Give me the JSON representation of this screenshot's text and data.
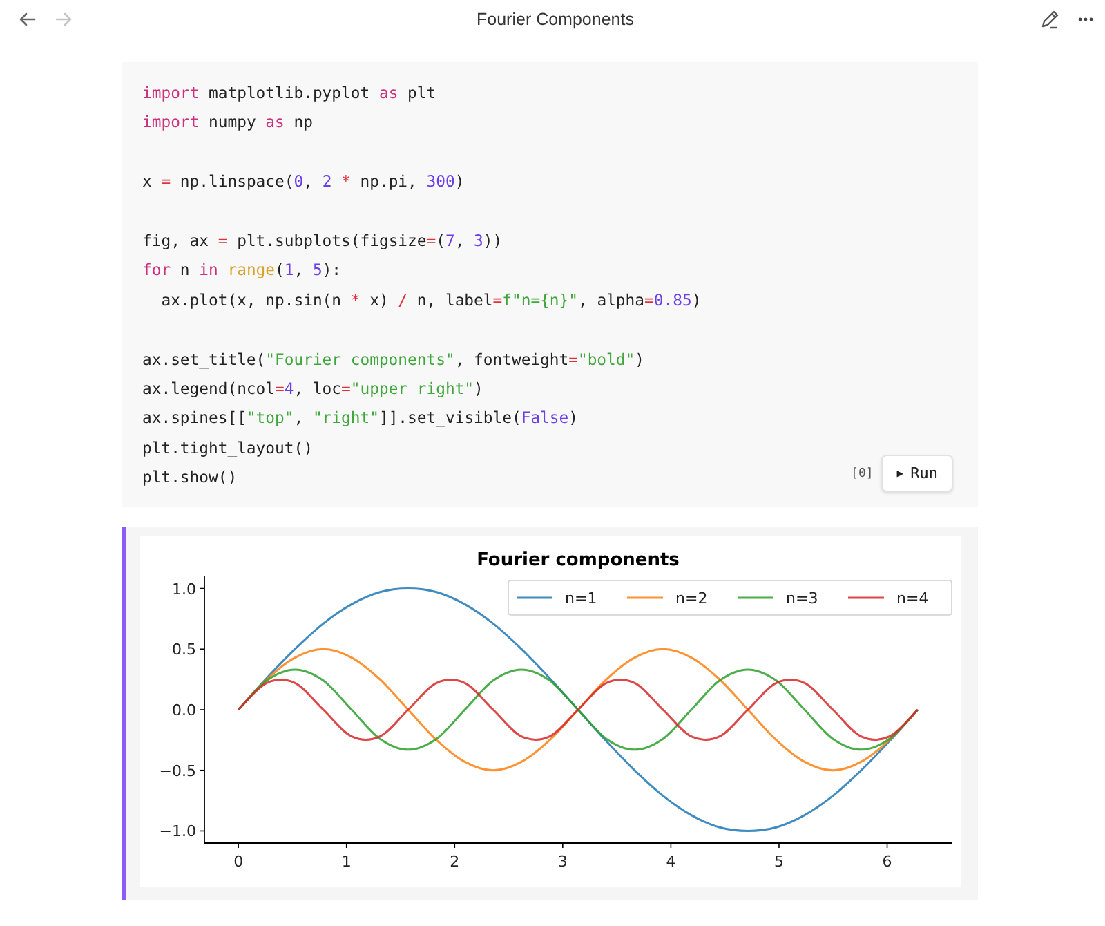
{
  "toolbar": {
    "back": {
      "disabled": false
    },
    "forward": {
      "disabled": true
    },
    "title": "Fourier Components"
  },
  "code_cell": {
    "lines": [
      {
        "kind": "code",
        "tokens": [
          {
            "kind": "keyword",
            "text": "import"
          },
          {
            "kind": "plain",
            "text": " matplotlib.pyplot "
          },
          {
            "kind": "keyword",
            "text": "as"
          },
          {
            "kind": "plain",
            "text": " plt"
          }
        ]
      },
      {
        "kind": "code",
        "tokens": [
          {
            "kind": "keyword",
            "text": "import"
          },
          {
            "kind": "plain",
            "text": " numpy "
          },
          {
            "kind": "keyword",
            "text": "as"
          },
          {
            "kind": "plain",
            "text": " np"
          }
        ]
      },
      {
        "kind": "blank"
      },
      {
        "kind": "code",
        "tokens": [
          {
            "kind": "plain",
            "text": "x "
          },
          {
            "kind": "operator",
            "text": "="
          },
          {
            "kind": "plain",
            "text": " np.linspace("
          },
          {
            "kind": "number",
            "text": "0"
          },
          {
            "kind": "plain",
            "text": ", "
          },
          {
            "kind": "number",
            "text": "2"
          },
          {
            "kind": "operator",
            "text": " *"
          },
          {
            "kind": "plain",
            "text": " np.pi, "
          },
          {
            "kind": "number",
            "text": "300"
          },
          {
            "kind": "plain",
            "text": ")"
          }
        ]
      },
      {
        "kind": "blank"
      },
      {
        "kind": "code",
        "tokens": [
          {
            "kind": "plain",
            "text": "fig, ax "
          },
          {
            "kind": "operator",
            "text": "="
          },
          {
            "kind": "plain",
            "text": " plt.subplots(figsize"
          },
          {
            "kind": "operator",
            "text": "="
          },
          {
            "kind": "plain",
            "text": "("
          },
          {
            "kind": "number",
            "text": "7"
          },
          {
            "kind": "plain",
            "text": ", "
          },
          {
            "kind": "number",
            "text": "3"
          },
          {
            "kind": "plain",
            "text": "))"
          }
        ]
      },
      {
        "kind": "code",
        "tokens": [
          {
            "kind": "keyword",
            "text": "for"
          },
          {
            "kind": "plain",
            "text": " n "
          },
          {
            "kind": "keyword",
            "text": "in"
          },
          {
            "kind": "builtin",
            "text": " range"
          },
          {
            "kind": "plain",
            "text": "("
          },
          {
            "kind": "number",
            "text": "1"
          },
          {
            "kind": "plain",
            "text": ", "
          },
          {
            "kind": "number",
            "text": "5"
          },
          {
            "kind": "plain",
            "text": "):"
          }
        ]
      },
      {
        "kind": "code",
        "tokens": [
          {
            "kind": "plain",
            "text": "  ax.plot(x, np.sin(n "
          },
          {
            "kind": "operator",
            "text": "*"
          },
          {
            "kind": "plain",
            "text": " x) "
          },
          {
            "kind": "operator",
            "text": "/"
          },
          {
            "kind": "plain",
            "text": " n, label"
          },
          {
            "kind": "operator",
            "text": "="
          },
          {
            "kind": "string",
            "text": "f\"n={n}\""
          },
          {
            "kind": "plain",
            "text": ", alpha"
          },
          {
            "kind": "operator",
            "text": "="
          },
          {
            "kind": "number",
            "text": "0.85"
          },
          {
            "kind": "plain",
            "text": ")"
          }
        ]
      },
      {
        "kind": "blank"
      },
      {
        "kind": "code",
        "tokens": [
          {
            "kind": "plain",
            "text": "ax.set_title("
          },
          {
            "kind": "string",
            "text": "\"Fourier components\""
          },
          {
            "kind": "plain",
            "text": ", fontweight"
          },
          {
            "kind": "operator",
            "text": "="
          },
          {
            "kind": "string",
            "text": "\"bold\""
          },
          {
            "kind": "plain",
            "text": ")"
          }
        ]
      },
      {
        "kind": "code",
        "tokens": [
          {
            "kind": "plain",
            "text": "ax.legend(ncol"
          },
          {
            "kind": "operator",
            "text": "="
          },
          {
            "kind": "number",
            "text": "4"
          },
          {
            "kind": "plain",
            "text": ", loc"
          },
          {
            "kind": "operator",
            "text": "="
          },
          {
            "kind": "string",
            "text": "\"upper right\""
          },
          {
            "kind": "plain",
            "text": ")"
          }
        ]
      },
      {
        "kind": "code",
        "tokens": [
          {
            "kind": "plain",
            "text": "ax.spines[["
          },
          {
            "kind": "string",
            "text": "\"top\""
          },
          {
            "kind": "plain",
            "text": ", "
          },
          {
            "kind": "string",
            "text": "\"right\""
          },
          {
            "kind": "plain",
            "text": "]].set_visible("
          },
          {
            "kind": "number",
            "text": "False"
          },
          {
            "kind": "plain",
            "text": ")"
          }
        ]
      },
      {
        "kind": "code",
        "tokens": [
          {
            "kind": "plain",
            "text": "plt.tight_layout()"
          }
        ]
      },
      {
        "kind": "code",
        "tokens": [
          {
            "kind": "plain",
            "text": "plt.show()"
          }
        ]
      }
    ],
    "execution_count": "[0]",
    "run_button": {
      "icon": "▶",
      "label": "Run"
    }
  },
  "output_cell": {
    "chart_data": {
      "type": "line",
      "title": "Fourier components",
      "x": [
        0,
        0.2618,
        0.5236,
        0.7854,
        1.0472,
        1.309,
        1.5708,
        1.8326,
        2.0944,
        2.3562,
        2.618,
        2.8798,
        3.1416,
        3.4034,
        3.6652,
        3.927,
        4.1888,
        4.4506,
        4.7124,
        4.9742,
        5.236,
        5.4978,
        5.7596,
        6.0214,
        6.2832
      ],
      "series": [
        {
          "name": "n=1",
          "color": "#1f77b4",
          "values": [
            0,
            0.26,
            0.5,
            0.71,
            0.87,
            0.97,
            1,
            0.97,
            0.87,
            0.71,
            0.5,
            0.26,
            0,
            -0.26,
            -0.5,
            -0.71,
            -0.87,
            -0.97,
            -1,
            -0.97,
            -0.87,
            -0.71,
            -0.5,
            -0.26,
            0
          ]
        },
        {
          "name": "n=2",
          "color": "#ff7f0e",
          "values": [
            0,
            0.25,
            0.43,
            0.5,
            0.43,
            0.25,
            0,
            -0.25,
            -0.43,
            -0.5,
            -0.43,
            -0.25,
            0,
            0.25,
            0.43,
            0.5,
            0.43,
            0.25,
            0,
            -0.25,
            -0.43,
            -0.5,
            -0.43,
            -0.25,
            0
          ]
        },
        {
          "name": "n=3",
          "color": "#2ca02c",
          "values": [
            0,
            0.24,
            0.33,
            0.24,
            0,
            -0.24,
            -0.33,
            -0.24,
            0,
            0.24,
            0.33,
            0.24,
            0,
            -0.24,
            -0.33,
            -0.24,
            0,
            0.24,
            0.33,
            0.24,
            0,
            -0.24,
            -0.33,
            -0.24,
            0
          ]
        },
        {
          "name": "n=4",
          "color": "#d62728",
          "values": [
            0,
            0.22,
            0.22,
            0,
            -0.22,
            -0.22,
            0,
            0.22,
            0.22,
            0,
            -0.22,
            -0.22,
            0,
            0.22,
            0.22,
            0,
            -0.22,
            -0.22,
            0,
            0.22,
            0.22,
            0,
            -0.22,
            -0.22,
            0
          ]
        }
      ],
      "legend": true,
      "xlim": [
        -0.314,
        6.597
      ],
      "ylim": [
        -1.1,
        1.1
      ],
      "xticks": [
        0,
        1,
        2,
        3,
        4,
        5,
        6
      ],
      "yticks": [
        {
          "value": -1,
          "label": "−1.0"
        },
        {
          "value": -0.5,
          "label": "−0.5"
        },
        {
          "value": 0,
          "label": "0.0"
        },
        {
          "value": 0.5,
          "label": "0.5"
        },
        {
          "value": 1,
          "label": "1.0"
        }
      ]
    }
  }
}
